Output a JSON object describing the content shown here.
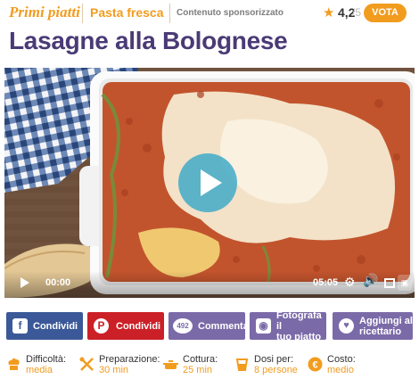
{
  "header": {
    "category_primary": "Primi piatti",
    "category_secondary": "Pasta fresca",
    "sponsored_label": "Contenuto sponsorizzato",
    "rating_value": "4,2",
    "rating_max": "/5",
    "vote_label": "VOTA",
    "accent_color": "#f29c1f"
  },
  "title": "Lasagne alla Bolognese",
  "video": {
    "current_time": "00:00",
    "duration": "05:05",
    "icons": [
      "play-icon",
      "settings-gear-icon",
      "volume-icon",
      "fullscreen-icon",
      "brand-logo-icon"
    ]
  },
  "actions": [
    {
      "label": "Condividi",
      "icon": "facebook-icon",
      "color": "#3b5998"
    },
    {
      "label": "Condividi",
      "icon": "pinterest-icon",
      "color": "#cb2027"
    },
    {
      "label": "Commenta",
      "count": "492",
      "icon": "comment-bubble-icon",
      "color": "#7b6aa8"
    },
    {
      "label_line1": "Fotografa il",
      "label_line2": "tuo piatto",
      "icon": "camera-icon",
      "color": "#7b6aa8"
    },
    {
      "label_line1": "Aggiungi al",
      "label_line2": "ricettario",
      "icon": "heart-icon",
      "color": "#7b6aa8"
    }
  ],
  "info": [
    {
      "label": "Difficoltà:",
      "value": "media",
      "icon": "chef-hat-icon"
    },
    {
      "label": "Preparazione:",
      "value": "30 min",
      "icon": "utensils-icon"
    },
    {
      "label": "Cottura:",
      "value": "25 min",
      "icon": "pot-icon"
    },
    {
      "label": "Dosi per:",
      "value": "8 persone",
      "icon": "serving-icon"
    },
    {
      "label": "Costo:",
      "value": "medio",
      "icon": "euro-coin-icon"
    }
  ]
}
